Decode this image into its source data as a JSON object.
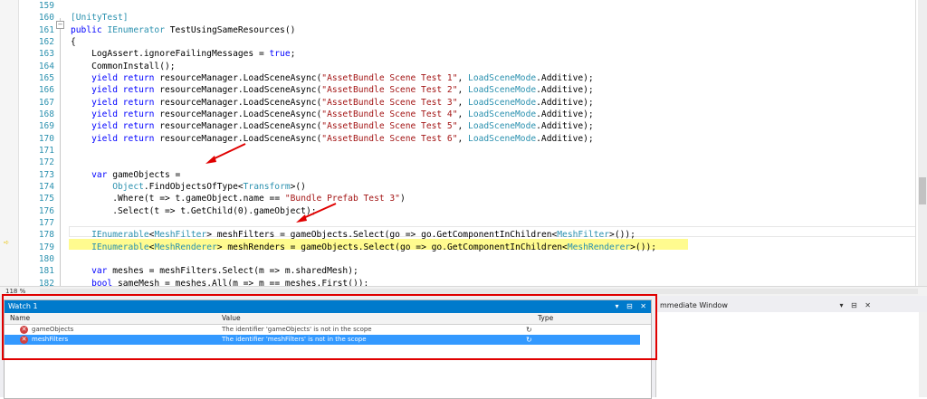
{
  "editor": {
    "line_numbers": [
      "159",
      "160",
      "161",
      "162",
      "163",
      "164",
      "165",
      "166",
      "167",
      "168",
      "169",
      "170",
      "171",
      "172",
      "173",
      "174",
      "175",
      "176",
      "177",
      "178",
      "179",
      "180",
      "181",
      "182"
    ],
    "lines": [
      "",
      "[UnityTest]",
      "public IEnumerator TestUsingSameResources()",
      "{",
      "    LogAssert.ignoreFailingMessages = true;",
      "    CommonInstall();",
      "    yield return resourceManager.LoadSceneAsync(\"AssetBundle Scene Test 1\", LoadSceneMode.Additive);",
      "    yield return resourceManager.LoadSceneAsync(\"AssetBundle Scene Test 2\", LoadSceneMode.Additive);",
      "    yield return resourceManager.LoadSceneAsync(\"AssetBundle Scene Test 3\", LoadSceneMode.Additive);",
      "    yield return resourceManager.LoadSceneAsync(\"AssetBundle Scene Test 4\", LoadSceneMode.Additive);",
      "    yield return resourceManager.LoadSceneAsync(\"AssetBundle Scene Test 5\", LoadSceneMode.Additive);",
      "    yield return resourceManager.LoadSceneAsync(\"AssetBundle Scene Test 6\", LoadSceneMode.Additive);",
      "",
      "",
      "    var gameObjects =",
      "        Object.FindObjectsOfType<Transform>()",
      "        .Where(t => t.gameObject.name == \"Bundle Prefab Test 3\")",
      "        .Select(t => t.GetChild(0).gameObject);",
      "",
      "    IEnumerable<MeshFilter> meshFilters = gameObjects.Select(go => go.GetComponentInChildren<MeshFilter>());",
      "    IEnumerable<MeshRenderer> meshRenders = gameObjects.Select(go => go.GetComponentInChildren<MeshRenderer>());",
      "",
      "    var meshes = meshFilters.Select(m => m.sharedMesh);",
      "    bool sameMesh = meshes.All(m => m == meshes.First());"
    ],
    "highlighted_line": "179",
    "zoom": "118 %"
  },
  "watch": {
    "title": "Watch 1",
    "columns": [
      "Name",
      "Value",
      "Type"
    ],
    "rows": [
      {
        "name": "gameObjects",
        "value": "The identifier 'gameObjects' is not in the scope",
        "type": ""
      },
      {
        "name": "meshFilters",
        "value": "The identifier 'meshFilters' is not in the scope",
        "type": ""
      }
    ]
  },
  "immediate": {
    "title": "mmediate Window"
  },
  "colors": {
    "accent": "#007acc",
    "selection": "#3399ff",
    "annotation": "#e00000",
    "current_line": "#fffb8f"
  }
}
